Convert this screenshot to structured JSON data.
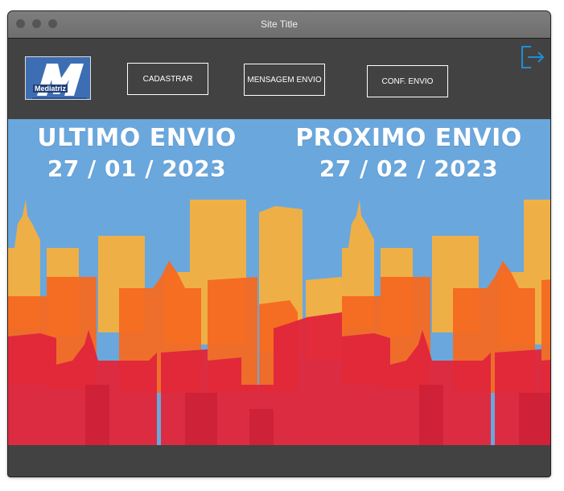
{
  "window": {
    "title": "Site Title"
  },
  "toolbar": {
    "logo_text": "Mediatriz",
    "buttons": [
      "CADASTRAR",
      "MENSAGEM ENVIO",
      "CONF. ENVIO"
    ]
  },
  "banner": {
    "ultimo": {
      "label": "ULTIMO ENVIO",
      "date": "27 / 01 / 2023"
    },
    "proximo": {
      "label": "PROXIMO ENVIO",
      "date": "27 / 02 / 2023"
    }
  },
  "icons": {
    "logout": "logout-icon"
  },
  "colors": {
    "window_bg": "#424242",
    "titlebar": "#767676",
    "logo_blue": "#3d6eb4",
    "sky": "#6aa7dd",
    "building_yellow": "#f5b041",
    "building_orange": "#f66a21",
    "building_red": "#e1273b",
    "logout_icon": "#1e8ed8"
  }
}
